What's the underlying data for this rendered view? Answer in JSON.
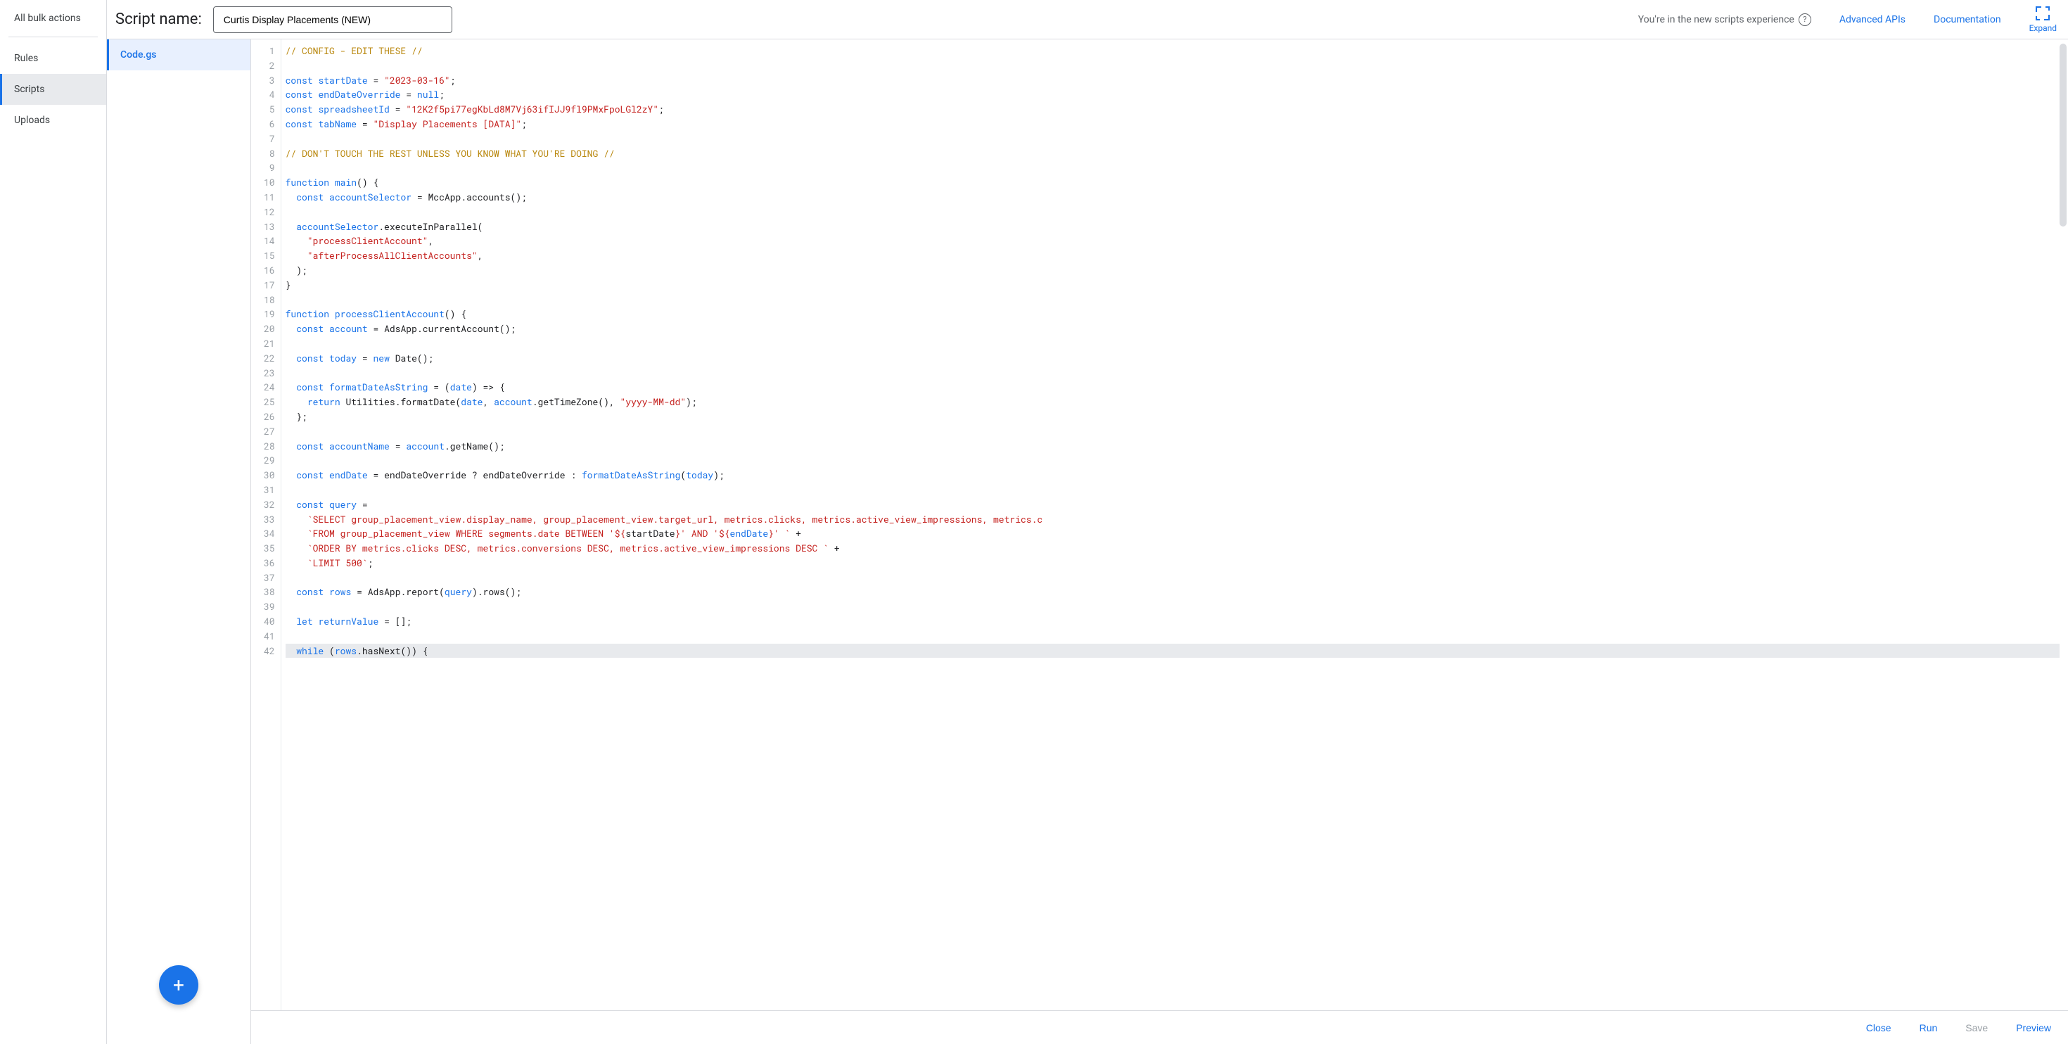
{
  "sidebar": {
    "header": "All bulk actions",
    "items": [
      "Rules",
      "Scripts",
      "Uploads"
    ],
    "active_index": 1
  },
  "topbar": {
    "script_name_label": "Script name:",
    "script_name_value": "Curtis Display Placements (NEW)",
    "info_text": "You're in the new scripts experience",
    "advanced_apis": "Advanced APIs",
    "documentation": "Documentation",
    "expand_label": "Expand"
  },
  "files": {
    "active": "Code.gs"
  },
  "fab_label": "+",
  "bottom": {
    "close": "Close",
    "run": "Run",
    "save": "Save",
    "preview": "Preview"
  },
  "editor": {
    "first_line": 1,
    "last_line": 42,
    "lines": [
      [
        [
          "comment",
          "// CONFIG - EDIT THESE //"
        ]
      ],
      [],
      [
        [
          "keyword",
          "const"
        ],
        [
          "plain",
          " "
        ],
        [
          "variable",
          "startDate"
        ],
        [
          "plain",
          " "
        ],
        [
          "punc",
          "="
        ],
        [
          "plain",
          " "
        ],
        [
          "string",
          "\"2023-03-16\""
        ],
        [
          "punc",
          ";"
        ]
      ],
      [
        [
          "keyword",
          "const"
        ],
        [
          "plain",
          " "
        ],
        [
          "variable",
          "endDateOverride"
        ],
        [
          "plain",
          " "
        ],
        [
          "punc",
          "="
        ],
        [
          "plain",
          " "
        ],
        [
          "atom",
          "null"
        ],
        [
          "punc",
          ";"
        ]
      ],
      [
        [
          "keyword",
          "const"
        ],
        [
          "plain",
          " "
        ],
        [
          "variable",
          "spreadsheetId"
        ],
        [
          "plain",
          " "
        ],
        [
          "punc",
          "="
        ],
        [
          "plain",
          " "
        ],
        [
          "string",
          "\"12K2f5pi77egKbLd8M7Vj63ifIJJ9fl9PMxFpoLGl2zY\""
        ],
        [
          "punc",
          ";"
        ]
      ],
      [
        [
          "keyword",
          "const"
        ],
        [
          "plain",
          " "
        ],
        [
          "variable",
          "tabName"
        ],
        [
          "plain",
          " "
        ],
        [
          "punc",
          "="
        ],
        [
          "plain",
          " "
        ],
        [
          "string",
          "\"Display Placements [DATA]\""
        ],
        [
          "punc",
          ";"
        ]
      ],
      [],
      [
        [
          "comment",
          "// DON'T TOUCH THE REST UNLESS YOU KNOW WHAT YOU'RE DOING //"
        ]
      ],
      [],
      [
        [
          "keyword",
          "function"
        ],
        [
          "plain",
          " "
        ],
        [
          "def",
          "main"
        ],
        [
          "punc",
          "() {"
        ]
      ],
      [
        [
          "plain",
          "  "
        ],
        [
          "keyword",
          "const"
        ],
        [
          "plain",
          " "
        ],
        [
          "variable",
          "accountSelector"
        ],
        [
          "plain",
          " "
        ],
        [
          "punc",
          "="
        ],
        [
          "plain",
          " MccApp.accounts();"
        ]
      ],
      [],
      [
        [
          "plain",
          "  "
        ],
        [
          "variable",
          "accountSelector"
        ],
        [
          "plain",
          ".executeInParallel("
        ]
      ],
      [
        [
          "plain",
          "    "
        ],
        [
          "string",
          "\"processClientAccount\""
        ],
        [
          "punc",
          ","
        ]
      ],
      [
        [
          "plain",
          "    "
        ],
        [
          "string",
          "\"afterProcessAllClientAccounts\""
        ],
        [
          "punc",
          ","
        ]
      ],
      [
        [
          "plain",
          "  );"
        ]
      ],
      [
        [
          "punc",
          "}"
        ]
      ],
      [],
      [
        [
          "keyword",
          "function"
        ],
        [
          "plain",
          " "
        ],
        [
          "def",
          "processClientAccount"
        ],
        [
          "punc",
          "() {"
        ]
      ],
      [
        [
          "plain",
          "  "
        ],
        [
          "keyword",
          "const"
        ],
        [
          "plain",
          " "
        ],
        [
          "variable",
          "account"
        ],
        [
          "plain",
          " "
        ],
        [
          "punc",
          "="
        ],
        [
          "plain",
          " AdsApp.currentAccount();"
        ]
      ],
      [],
      [
        [
          "plain",
          "  "
        ],
        [
          "keyword",
          "const"
        ],
        [
          "plain",
          " "
        ],
        [
          "variable",
          "today"
        ],
        [
          "plain",
          " "
        ],
        [
          "punc",
          "="
        ],
        [
          "plain",
          " "
        ],
        [
          "keyword",
          "new"
        ],
        [
          "plain",
          " Date();"
        ]
      ],
      [],
      [
        [
          "plain",
          "  "
        ],
        [
          "keyword",
          "const"
        ],
        [
          "plain",
          " "
        ],
        [
          "variable",
          "formatDateAsString"
        ],
        [
          "plain",
          " "
        ],
        [
          "punc",
          "="
        ],
        [
          "plain",
          " ("
        ],
        [
          "variable",
          "date"
        ],
        [
          "plain",
          ") "
        ],
        [
          "punc",
          "=>"
        ],
        [
          "plain",
          " {"
        ]
      ],
      [
        [
          "plain",
          "    "
        ],
        [
          "keyword",
          "return"
        ],
        [
          "plain",
          " Utilities.formatDate("
        ],
        [
          "variable",
          "date"
        ],
        [
          "punc",
          ", "
        ],
        [
          "variable",
          "account"
        ],
        [
          "plain",
          ".getTimeZone(), "
        ],
        [
          "string",
          "\"yyyy-MM-dd\""
        ],
        [
          "punc",
          ");"
        ]
      ],
      [
        [
          "plain",
          "  };"
        ]
      ],
      [],
      [
        [
          "plain",
          "  "
        ],
        [
          "keyword",
          "const"
        ],
        [
          "plain",
          " "
        ],
        [
          "variable",
          "accountName"
        ],
        [
          "plain",
          " "
        ],
        [
          "punc",
          "="
        ],
        [
          "plain",
          " "
        ],
        [
          "variable",
          "account"
        ],
        [
          "plain",
          ".getName();"
        ]
      ],
      [],
      [
        [
          "plain",
          "  "
        ],
        [
          "keyword",
          "const"
        ],
        [
          "plain",
          " "
        ],
        [
          "variable",
          "endDate"
        ],
        [
          "plain",
          " "
        ],
        [
          "punc",
          "="
        ],
        [
          "plain",
          " endDateOverride "
        ],
        [
          "punc",
          "?"
        ],
        [
          "plain",
          " endDateOverride "
        ],
        [
          "punc",
          ":"
        ],
        [
          "plain",
          " "
        ],
        [
          "variable",
          "formatDateAsString"
        ],
        [
          "punc",
          "("
        ],
        [
          "variable",
          "today"
        ],
        [
          "punc",
          ");"
        ]
      ],
      [],
      [
        [
          "plain",
          "  "
        ],
        [
          "keyword",
          "const"
        ],
        [
          "plain",
          " "
        ],
        [
          "variable",
          "query"
        ],
        [
          "plain",
          " "
        ],
        [
          "punc",
          "="
        ]
      ],
      [
        [
          "plain",
          "    "
        ],
        [
          "string",
          "`SELECT group_placement_view.display_name, group_placement_view.target_url, metrics.clicks, metrics.active_view_impressions, metrics.c"
        ]
      ],
      [
        [
          "plain",
          "    "
        ],
        [
          "string",
          "`FROM group_placement_view WHERE segments.date BETWEEN '${"
        ],
        [
          "plain",
          "startDate"
        ],
        [
          "string",
          "}' AND '${"
        ],
        [
          "variable",
          "endDate"
        ],
        [
          "string",
          "}' `"
        ],
        [
          "plain",
          " +"
        ]
      ],
      [
        [
          "plain",
          "    "
        ],
        [
          "string",
          "`ORDER BY metrics.clicks DESC, metrics.conversions DESC, metrics.active_view_impressions DESC `"
        ],
        [
          "plain",
          " +"
        ]
      ],
      [
        [
          "plain",
          "    "
        ],
        [
          "string",
          "`LIMIT 500`"
        ],
        [
          "punc",
          ";"
        ]
      ],
      [],
      [
        [
          "plain",
          "  "
        ],
        [
          "keyword",
          "const"
        ],
        [
          "plain",
          " "
        ],
        [
          "variable",
          "rows"
        ],
        [
          "plain",
          " "
        ],
        [
          "punc",
          "="
        ],
        [
          "plain",
          " AdsApp.report("
        ],
        [
          "variable",
          "query"
        ],
        [
          "plain",
          ").rows();"
        ]
      ],
      [],
      [
        [
          "plain",
          "  "
        ],
        [
          "keyword",
          "let"
        ],
        [
          "plain",
          " "
        ],
        [
          "variable",
          "returnValue"
        ],
        [
          "plain",
          " "
        ],
        [
          "punc",
          "="
        ],
        [
          "plain",
          " [];"
        ]
      ],
      [],
      [
        [
          "plain",
          "  "
        ],
        [
          "keyword",
          "while"
        ],
        [
          "plain",
          " ("
        ],
        [
          "variable",
          "rows"
        ],
        [
          "plain",
          ".hasNext()) {"
        ]
      ]
    ],
    "highlighted_line_index": 41
  }
}
